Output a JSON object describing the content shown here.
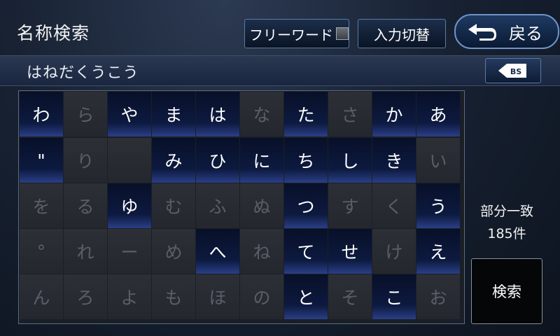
{
  "header": {
    "title": "名称検索",
    "free_word_label": "フリーワード",
    "switch_label": "入力切替",
    "back_label": "戻る"
  },
  "input": {
    "text": "はねだくうこう",
    "backspace_label": "BS"
  },
  "keyboard": {
    "rows": [
      [
        {
          "c": "わ",
          "on": true
        },
        {
          "c": "ら",
          "on": false
        },
        {
          "c": "や",
          "on": true
        },
        {
          "c": "ま",
          "on": true
        },
        {
          "c": "は",
          "on": true
        },
        {
          "c": "な",
          "on": false
        },
        {
          "c": "た",
          "on": true
        },
        {
          "c": "さ",
          "on": false
        },
        {
          "c": "か",
          "on": true
        },
        {
          "c": "あ",
          "on": true
        }
      ],
      [
        {
          "c": "\"",
          "on": true
        },
        {
          "c": "り",
          "on": false
        },
        {
          "c": "",
          "on": false
        },
        {
          "c": "み",
          "on": true
        },
        {
          "c": "ひ",
          "on": true
        },
        {
          "c": "に",
          "on": true
        },
        {
          "c": "ち",
          "on": true
        },
        {
          "c": "し",
          "on": true
        },
        {
          "c": "き",
          "on": true
        },
        {
          "c": "い",
          "on": false
        }
      ],
      [
        {
          "c": "を",
          "on": false
        },
        {
          "c": "る",
          "on": false
        },
        {
          "c": "ゆ",
          "on": true
        },
        {
          "c": "む",
          "on": false
        },
        {
          "c": "ふ",
          "on": false
        },
        {
          "c": "ぬ",
          "on": false
        },
        {
          "c": "つ",
          "on": true
        },
        {
          "c": "す",
          "on": false
        },
        {
          "c": "く",
          "on": false
        },
        {
          "c": "う",
          "on": true
        }
      ],
      [
        {
          "c": "°",
          "on": false
        },
        {
          "c": "れ",
          "on": false
        },
        {
          "c": "ー",
          "on": false
        },
        {
          "c": "め",
          "on": false
        },
        {
          "c": "へ",
          "on": true
        },
        {
          "c": "ね",
          "on": false
        },
        {
          "c": "て",
          "on": true
        },
        {
          "c": "せ",
          "on": true
        },
        {
          "c": "け",
          "on": false
        },
        {
          "c": "え",
          "on": true
        }
      ],
      [
        {
          "c": "ん",
          "on": false
        },
        {
          "c": "ろ",
          "on": false
        },
        {
          "c": "よ",
          "on": false
        },
        {
          "c": "も",
          "on": false
        },
        {
          "c": "ほ",
          "on": false
        },
        {
          "c": "の",
          "on": false
        },
        {
          "c": "と",
          "on": true
        },
        {
          "c": "そ",
          "on": false
        },
        {
          "c": "こ",
          "on": true
        },
        {
          "c": "お",
          "on": false
        }
      ]
    ]
  },
  "status": {
    "match_type": "部分一致",
    "count": "185件"
  },
  "search_button_label": "検索",
  "colors": {
    "key_active_dark": "#081028",
    "key_active_glow": "#2a3f86",
    "key_inactive": "#2c3036",
    "key_inactive_text": "#5a5f67",
    "accent_border": "#5a7aa8"
  }
}
